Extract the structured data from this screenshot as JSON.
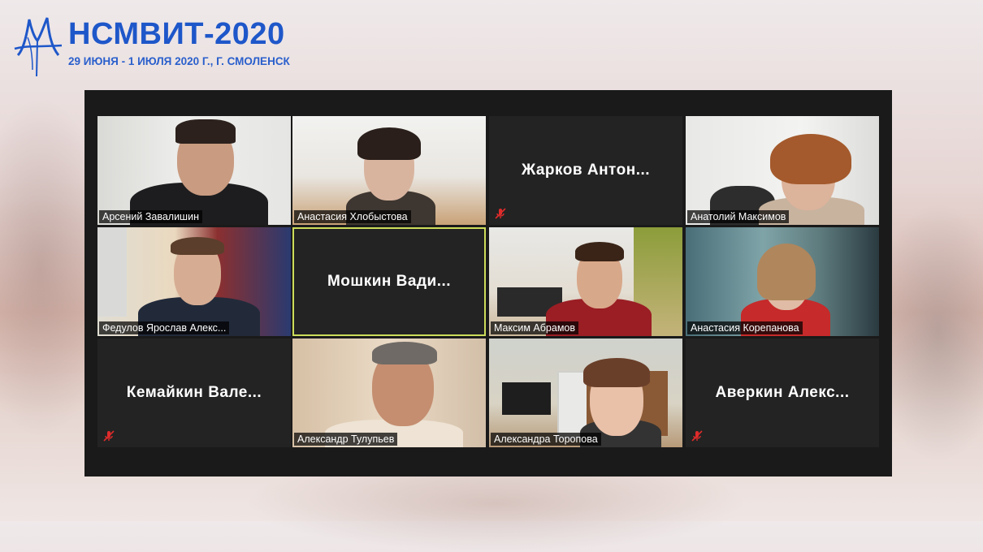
{
  "event": {
    "title": "НСМВИТ-2020",
    "subtitle": "29 ИЮНЯ - 1 ИЮЛЯ 2020 Г., Г. СМОЛЕНСК"
  },
  "colors": {
    "brand": "#1e57c9",
    "speaker_highlight": "#cddc5a",
    "tile_bg": "#232323",
    "mute_red": "#e02b2b"
  },
  "participants": [
    {
      "name": "Арсений Завалишин",
      "video": true,
      "muted": false
    },
    {
      "name": "Анастасия Хлобыстова",
      "video": true,
      "muted": false
    },
    {
      "name": "Жарков Антон...",
      "video": false,
      "muted": true
    },
    {
      "name": "Анатолий Максимов",
      "video": true,
      "muted": false
    },
    {
      "name": "Федулов Ярослав Алекс...",
      "video": true,
      "muted": false
    },
    {
      "name": "Мошкин Вади...",
      "video": false,
      "muted": false,
      "active_speaker": true
    },
    {
      "name": "Максим Абрамов",
      "video": true,
      "muted": false
    },
    {
      "name": "Анастасия Корепанова",
      "video": true,
      "muted": false
    },
    {
      "name": "Кемайкин Вале...",
      "video": false,
      "muted": true
    },
    {
      "name": "Александр Тулупьев",
      "video": true,
      "muted": false
    },
    {
      "name": "Александра Торопова",
      "video": true,
      "muted": false
    },
    {
      "name": "Аверкин Алекс...",
      "video": false,
      "muted": true
    }
  ]
}
